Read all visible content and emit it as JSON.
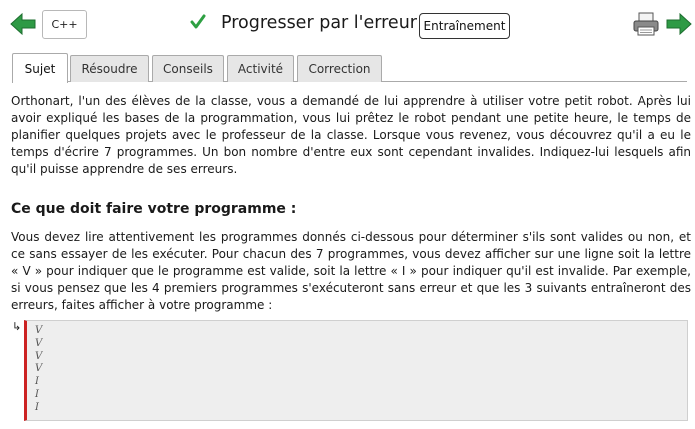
{
  "header": {
    "language": "C++",
    "title": "Progresser par l'erreur",
    "mode_badge": "Entraînement"
  },
  "colors": {
    "accent_green": "#2ea043",
    "error_border": "#cc2222"
  },
  "icons": {
    "prev": "arrow-left-icon",
    "next": "arrow-right-icon",
    "status": "checkmark-icon",
    "print": "printer-icon"
  },
  "tabs": [
    {
      "label": "Sujet",
      "active": true
    },
    {
      "label": "Résoudre",
      "active": false
    },
    {
      "label": "Conseils",
      "active": false
    },
    {
      "label": "Activité",
      "active": false
    },
    {
      "label": "Correction",
      "active": false
    }
  ],
  "statement": {
    "intro": "Orthonart, l'un des élèves de la classe, vous a demandé de lui apprendre à utiliser votre petit robot. Après lui avoir expliqué les bases de la programmation, vous lui prêtez le robot pendant une petite heure, le temps de planifier quelques projets avec le professeur de la classe. Lorsque vous revenez, vous découvrez qu'il a eu le temps d'écrire 7 programmes. Un bon nombre d'entre eux sont cependant invalides. Indiquez-lui lesquels afin qu'il puisse apprendre de ses erreurs.",
    "section_title": "Ce que doit faire votre programme :",
    "task": "Vous devez lire attentivement les programmes donnés ci-dessous pour déterminer s'ils sont valides ou non, et ce sans essayer de les exécuter. Pour chacun des 7 programmes, vous devez afficher sur une ligne soit la lettre « V » pour indiquer que le programme est valide, soit la lettre « I » pour indiquer qu'il est invalide. Par exemple, si vous pensez que les 4 premiers programmes s'exécuteront sans erreur et que les 3 suivants entraîneront des erreurs, faites afficher à votre programme :"
  },
  "example_output": {
    "arrow": "↳",
    "lines": [
      "V",
      "V",
      "V",
      "V",
      "I",
      "I",
      "I"
    ]
  }
}
